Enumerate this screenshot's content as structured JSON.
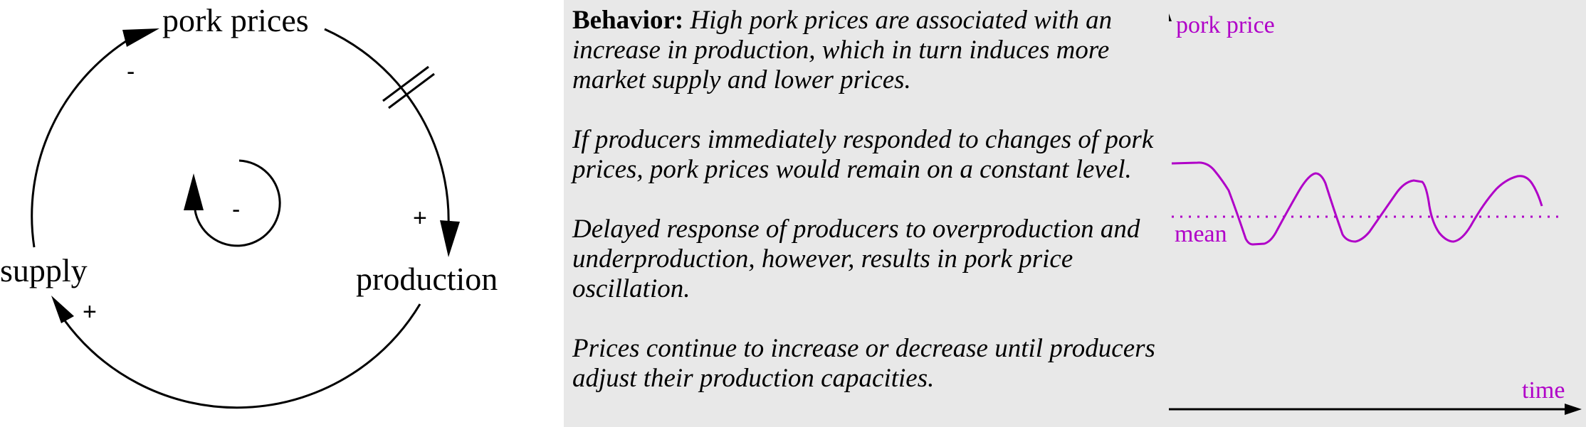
{
  "loop": {
    "nodes": {
      "pork_prices": "pork prices",
      "production": "production",
      "supply": "supply"
    },
    "link_signs": {
      "prices_to_production": "+",
      "production_to_supply": "+",
      "supply_to_prices": "-",
      "loop_polarity": "-"
    },
    "delay_marker": "delay"
  },
  "behavior": {
    "heading": "Behavior:",
    "paragraphs": [
      "High pork prices are associated with an increase in production, which in turn induces more market supply and lower prices.",
      "If producers immediately responded to changes of pork prices, pork prices would remain on a constant level.",
      "Delayed response of producers to overproduction and underproduction, however, results in pork price oscillation.",
      "Prices continue to increase or decrease until producers adjust their production capacities."
    ]
  },
  "graph": {
    "y_label": "pork price",
    "x_label": "time",
    "mean_label": "mean",
    "color": "#b000c8",
    "panel_background": "#e8e8e8"
  }
}
